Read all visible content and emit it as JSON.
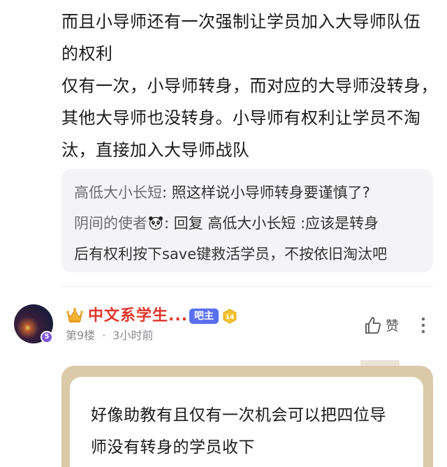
{
  "post": {
    "lines": [
      "而且小导师还有一次强制让学员加入大导师队伍",
      "的权利",
      "仅有一次，小导师转身，而对应的大导师没转身，",
      "其他大导师也没转身。小导师有权利让学员不淘",
      "汰，直接加入大导师战队"
    ]
  },
  "replies": {
    "r1_author": "高低大小长短",
    "r1_text": ": 照这样说小导师转身要谨慎了?",
    "r2_author": "阴间的使者",
    "r2_text": ": 回复 高低大小长短 :应该是转身",
    "r2_cont": "后有权利按下save键救活学员，不按依旧淘汰吧"
  },
  "floor": {
    "avatar_level": "5",
    "username": "中文系学生...",
    "owner_label": "吧主",
    "level": "14",
    "floor_no": "第9楼",
    "dot": "·",
    "time": "3小时前",
    "like_label": "赞"
  },
  "quote": {
    "lines": [
      "好像助教有且仅有一次机会可以把四位导",
      "师没有转身的学员收下"
    ]
  },
  "colors": {
    "username": "#e0352b",
    "owner_badge": "#5a6ff0",
    "level_badge": "#f2c230",
    "quote_frame": "#dcc9a8"
  }
}
